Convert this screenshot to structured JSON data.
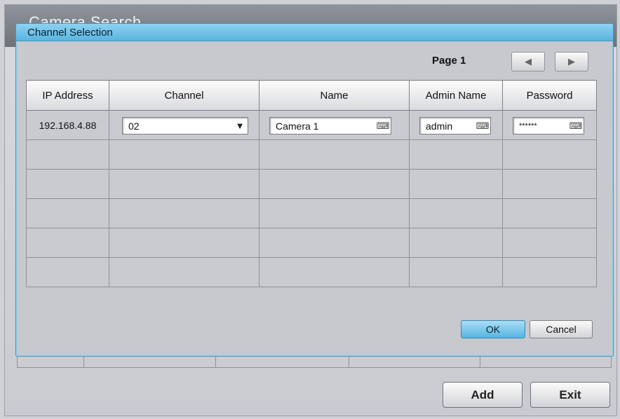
{
  "background_window": {
    "title": "Camera Search",
    "add_label": "Add",
    "exit_label": "Exit"
  },
  "dialog": {
    "title": "Channel Selection",
    "page_label": "Page 1",
    "prev_icon": "triangle-left-icon",
    "next_icon": "triangle-right-icon",
    "columns": [
      "IP Address",
      "Channel",
      "Name",
      "Admin Name",
      "Password"
    ],
    "rows": [
      {
        "ip": "192.168.4.88",
        "channel": "02",
        "name": "Camera 1",
        "admin_name": "admin",
        "password": "******"
      }
    ],
    "empty_rows": 5,
    "ok_label": "OK",
    "cancel_label": "Cancel"
  },
  "colors": {
    "accent": "#5ab4df",
    "dialog_bg": "#c7c9ce"
  }
}
